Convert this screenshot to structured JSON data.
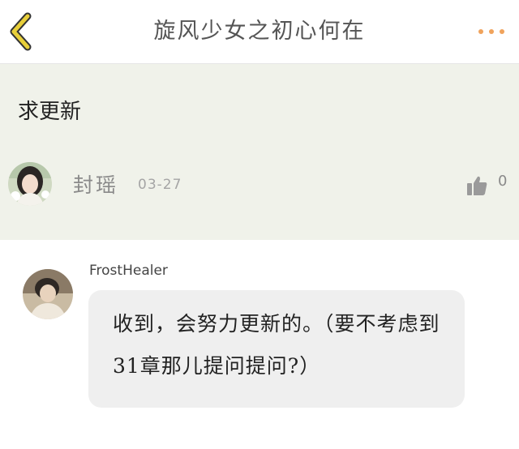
{
  "header": {
    "title": "旋风少女之初心何在",
    "back_icon": "chevron-left-icon",
    "more_icon": "more-dots-icon",
    "accent_color": "#f0a35c",
    "back_color": "#e8cf3a"
  },
  "post": {
    "text": "求更新",
    "author": "封瑶",
    "date": "03-27",
    "like_icon": "thumbs-up-icon",
    "like_count": "0",
    "background": "#f0f2ea"
  },
  "reply": {
    "author": "FrostHealer",
    "text": "收到，会努力更新的。（要不考虑到31章那儿提问提问?）",
    "bubble_color": "#efefef"
  }
}
